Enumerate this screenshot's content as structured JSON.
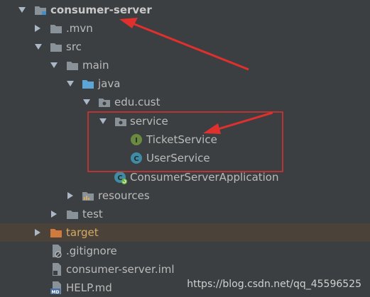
{
  "tree": {
    "root": "consumer-server",
    "mvn": ".mvn",
    "src": "src",
    "main": "main",
    "java": "java",
    "package": "edu.cust",
    "service": "service",
    "ticket_service": "TicketService",
    "user_service": "UserService",
    "app_class": "ConsumerServerApplication",
    "resources": "resources",
    "test": "test",
    "target": "target",
    "gitignore": ".gitignore",
    "iml": "consumer-server.iml",
    "help": "HELP.md"
  },
  "icons": {
    "interface_letter": "I",
    "class_letter": "C",
    "md_badge": "MD"
  },
  "watermark": "https://blog.csdn.net/qq_45596525",
  "colors": {
    "background": "#3c3f41",
    "selected_row": "#4b4239",
    "folder": "#8a9299",
    "source_folder": "#5da5d5",
    "excluded_folder": "#d07a3e",
    "interface_icon": "#6a8a3f",
    "class_icon": "#3e8ca6",
    "annotation_red": "#e0302e"
  }
}
